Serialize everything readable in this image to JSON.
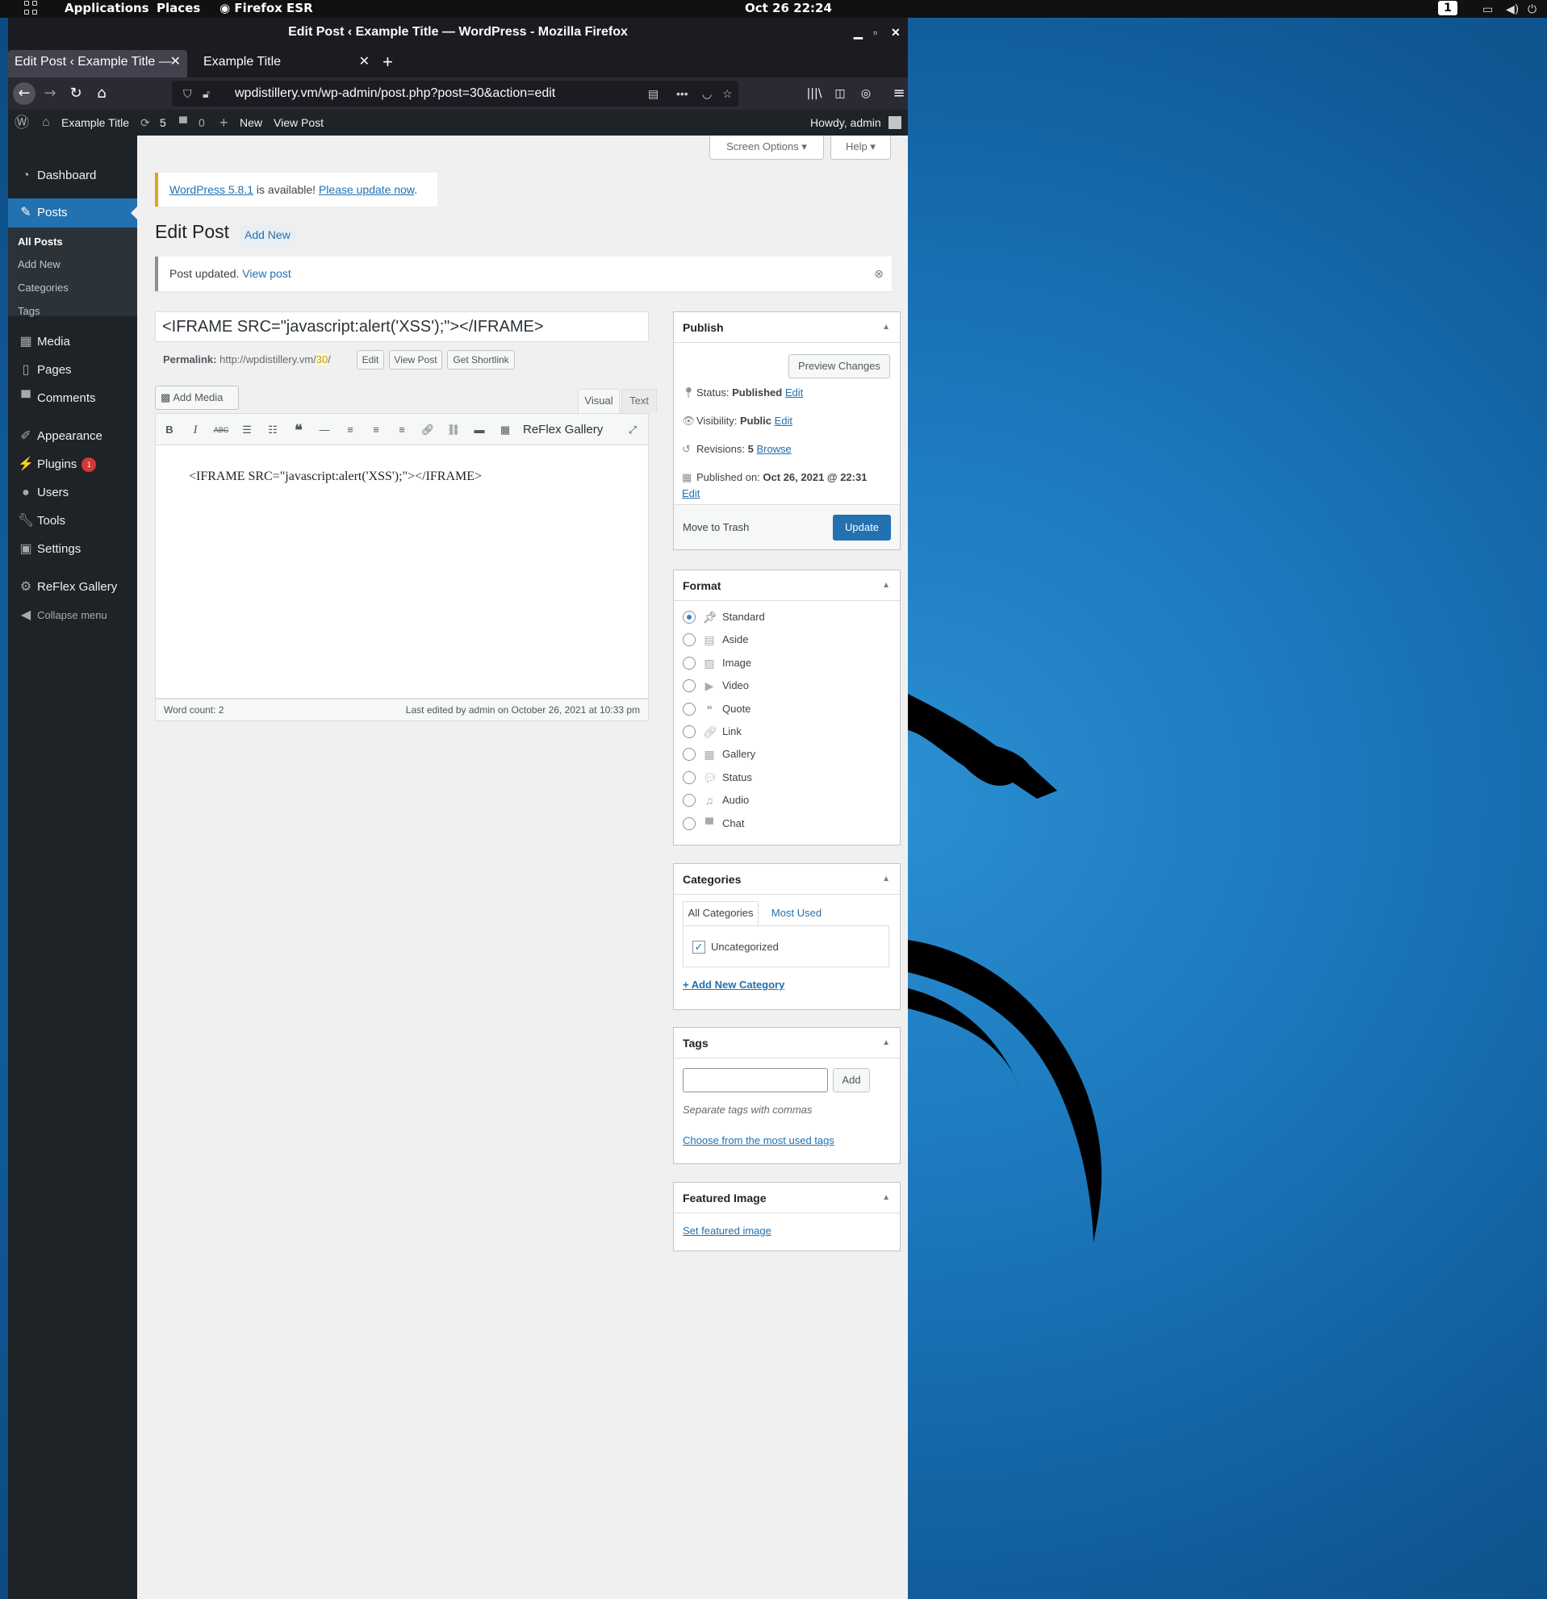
{
  "system_bar": {
    "applications": "Applications",
    "places": "Places",
    "firefox": "Firefox ESR",
    "clock": "Oct 26  22:24",
    "workspace": "1"
  },
  "browser": {
    "window_title": "Edit Post ‹ Example Title — WordPress - Mozilla Firefox",
    "tabs": [
      {
        "label": "Edit Post ‹ Example Title —"
      },
      {
        "label": "Example Title"
      }
    ],
    "url": "wpdistillery.vm/wp-admin/post.php?post=30&action=edit"
  },
  "admin_bar": {
    "site_name": "Example Title",
    "updates_count": "5",
    "comments_count": "0",
    "new_label": "New",
    "view_post": "View Post",
    "howdy": "Howdy, admin"
  },
  "menu": {
    "dashboard": "Dashboard",
    "posts": "Posts",
    "sub": [
      "All Posts",
      "Add New",
      "Categories",
      "Tags"
    ],
    "media": "Media",
    "pages": "Pages",
    "comments": "Comments",
    "appearance": "Appearance",
    "plugins": "Plugins",
    "plugins_badge": "1",
    "users": "Users",
    "tools": "Tools",
    "settings": "Settings",
    "reflex": "ReFlex Gallery",
    "collapse": "Collapse menu"
  },
  "page": {
    "screen_options": "Screen Options",
    "help": "Help",
    "update_link": "WordPress 5.8.1",
    "update_mid": " is available! ",
    "update_now": "Please update now",
    "update_dot": ".",
    "heading": "Edit Post",
    "add_new": "Add New",
    "notice_text": "Post updated.",
    "notice_link": "View post",
    "post_title": "<IFRAME SRC=\"javascript:alert('XSS');\"></IFRAME>",
    "permalink_label": "Permalink:",
    "permalink_base": "http://wpdistillery.vm/",
    "permalink_slug": "30",
    "permalink_end": "/",
    "btn_edit": "Edit",
    "btn_view_post": "View Post",
    "btn_shortlink": "Get Shortlink",
    "add_media": "Add Media",
    "tab_visual": "Visual",
    "tab_text": "Text",
    "reflex_toolbar": "ReFlex Gallery",
    "editor_content": "<IFRAME SRC=\"javascript:alert('XSS');\"></IFRAME>",
    "word_count": "Word count: 2",
    "last_edited": "Last edited by admin on October 26, 2021 at 10:33 pm"
  },
  "publish": {
    "title": "Publish",
    "preview": "Preview Changes",
    "status_label": "Status: ",
    "status_value": "Published",
    "visibility_label": "Visibility: ",
    "visibility_value": "Public",
    "revisions_label": "Revisions: ",
    "revisions_value": "5",
    "browse": "Browse",
    "published_label": "Published on: ",
    "published_value": "Oct 26, 2021 @ 22:31",
    "edit": "Edit",
    "trash": "Move to Trash",
    "update": "Update"
  },
  "format": {
    "title": "Format",
    "options": [
      "Standard",
      "Aside",
      "Image",
      "Video",
      "Quote",
      "Link",
      "Gallery",
      "Status",
      "Audio",
      "Chat"
    ],
    "selected": "Standard"
  },
  "categories": {
    "title": "Categories",
    "tab_all": "All Categories",
    "tab_most": "Most Used",
    "item": "Uncategorized",
    "add_new": "+ Add New Category"
  },
  "tags": {
    "title": "Tags",
    "add": "Add",
    "hint": "Separate tags with commas",
    "choose": "Choose from the most used tags"
  },
  "featured": {
    "title": "Featured Image",
    "set": "Set featured image"
  },
  "colors": {
    "wp_blue": "#2271b1",
    "admin_dark": "#1d2327",
    "desktop_blue": "#1c78bd"
  }
}
